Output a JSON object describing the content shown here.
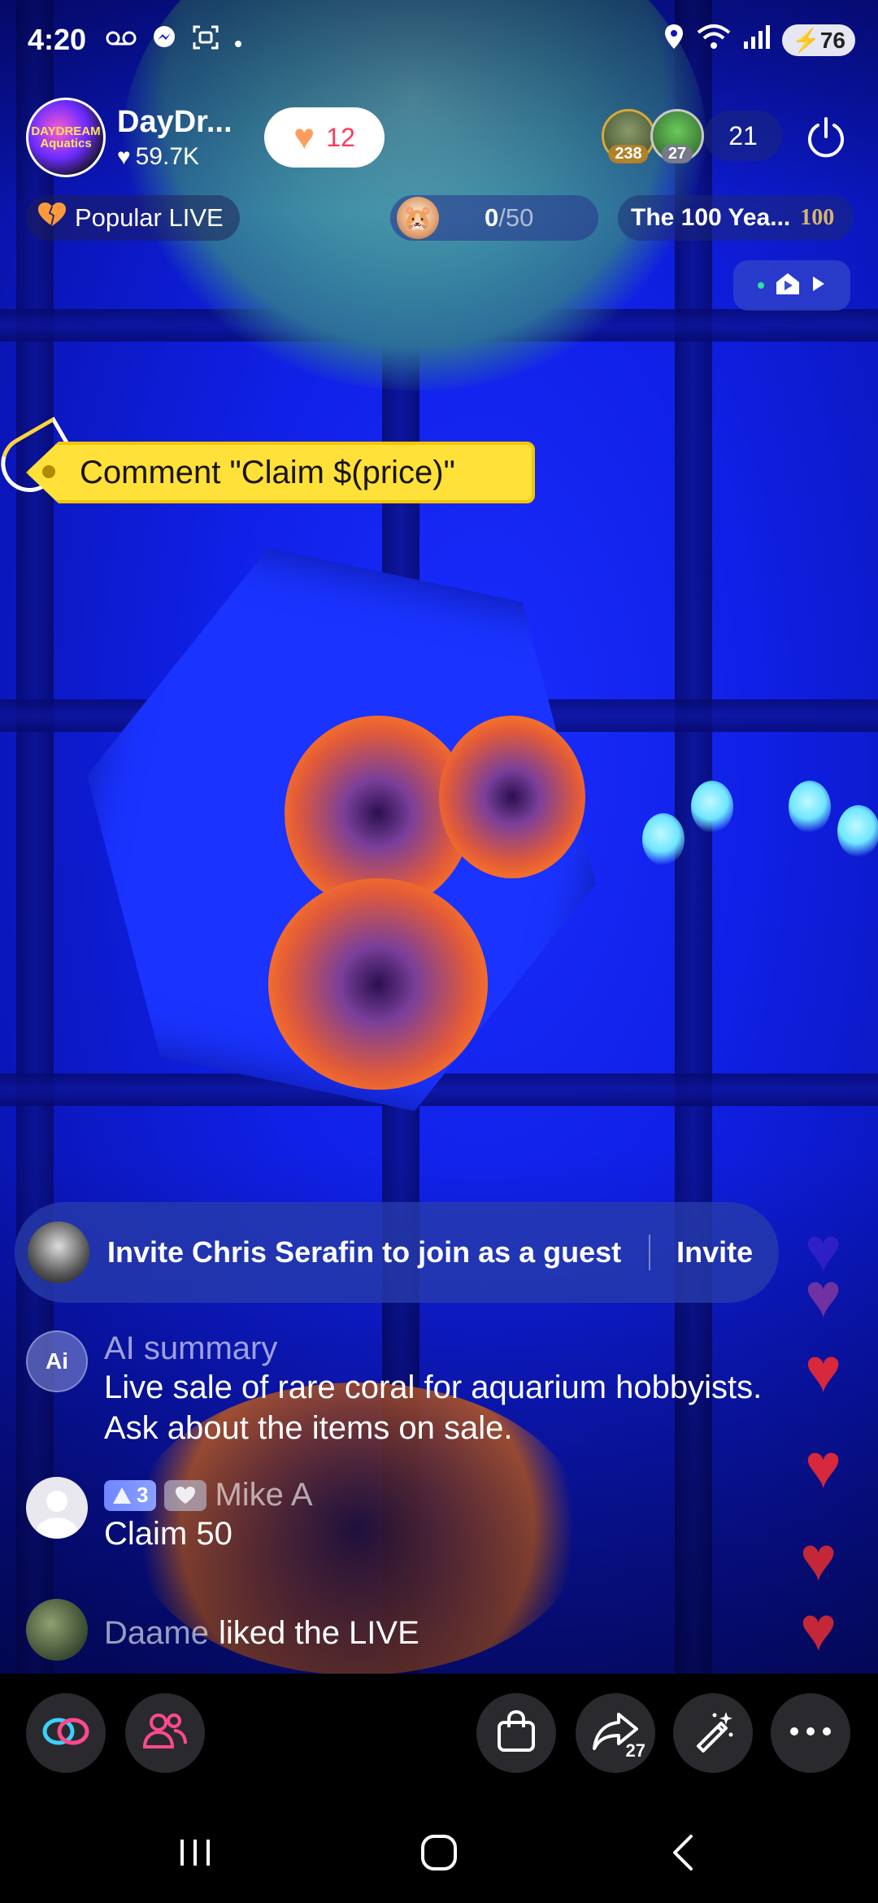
{
  "status_bar": {
    "time": "4:20",
    "battery": "76",
    "left_icons": [
      "voicemail-icon",
      "messenger-icon",
      "screenshot-icon",
      "dot-icon"
    ],
    "right_icons": [
      "location-icon",
      "wifi-icon",
      "signal-icon",
      "battery-icon"
    ]
  },
  "host": {
    "avatar_text": "DAYDREAM Aquatics",
    "name": "DayDr...",
    "likes": "59.7K"
  },
  "like_pill": {
    "count": "12"
  },
  "viewers": {
    "top1_badge": "238",
    "top2_badge": "27",
    "count": "21"
  },
  "row2": {
    "popular_label": "Popular LIVE",
    "goal_current": "0",
    "goal_total": "/50",
    "sponsor_label": "The 100 Yea...",
    "sponsor_logo": "100"
  },
  "sticker": {
    "text": "Comment \"Claim $(price)\""
  },
  "invite": {
    "text": "Invite Chris Serafin to join as a guest",
    "button": "Invite"
  },
  "comments": [
    {
      "name": "AI summary",
      "avatar_text": "Ai",
      "text_line1": "Live sale of rare coral for aquarium hobbyists.",
      "text_line2": "Ask about the items on sale."
    },
    {
      "name": "Mike A",
      "badge_level": "3",
      "text": "Claim 50"
    },
    {
      "name": "Daame",
      "text": "liked the LIVE"
    }
  ],
  "toolbar": {
    "share_count": "27",
    "buttons": [
      "link-icon",
      "guests-icon",
      "shop-bag-icon",
      "share-icon",
      "magic-wand-icon",
      "more-icon"
    ]
  },
  "colors": {
    "accent_red": "#ff3b5c",
    "sticker_yellow": "#ffe13a",
    "video_blue": "#1020e6"
  }
}
